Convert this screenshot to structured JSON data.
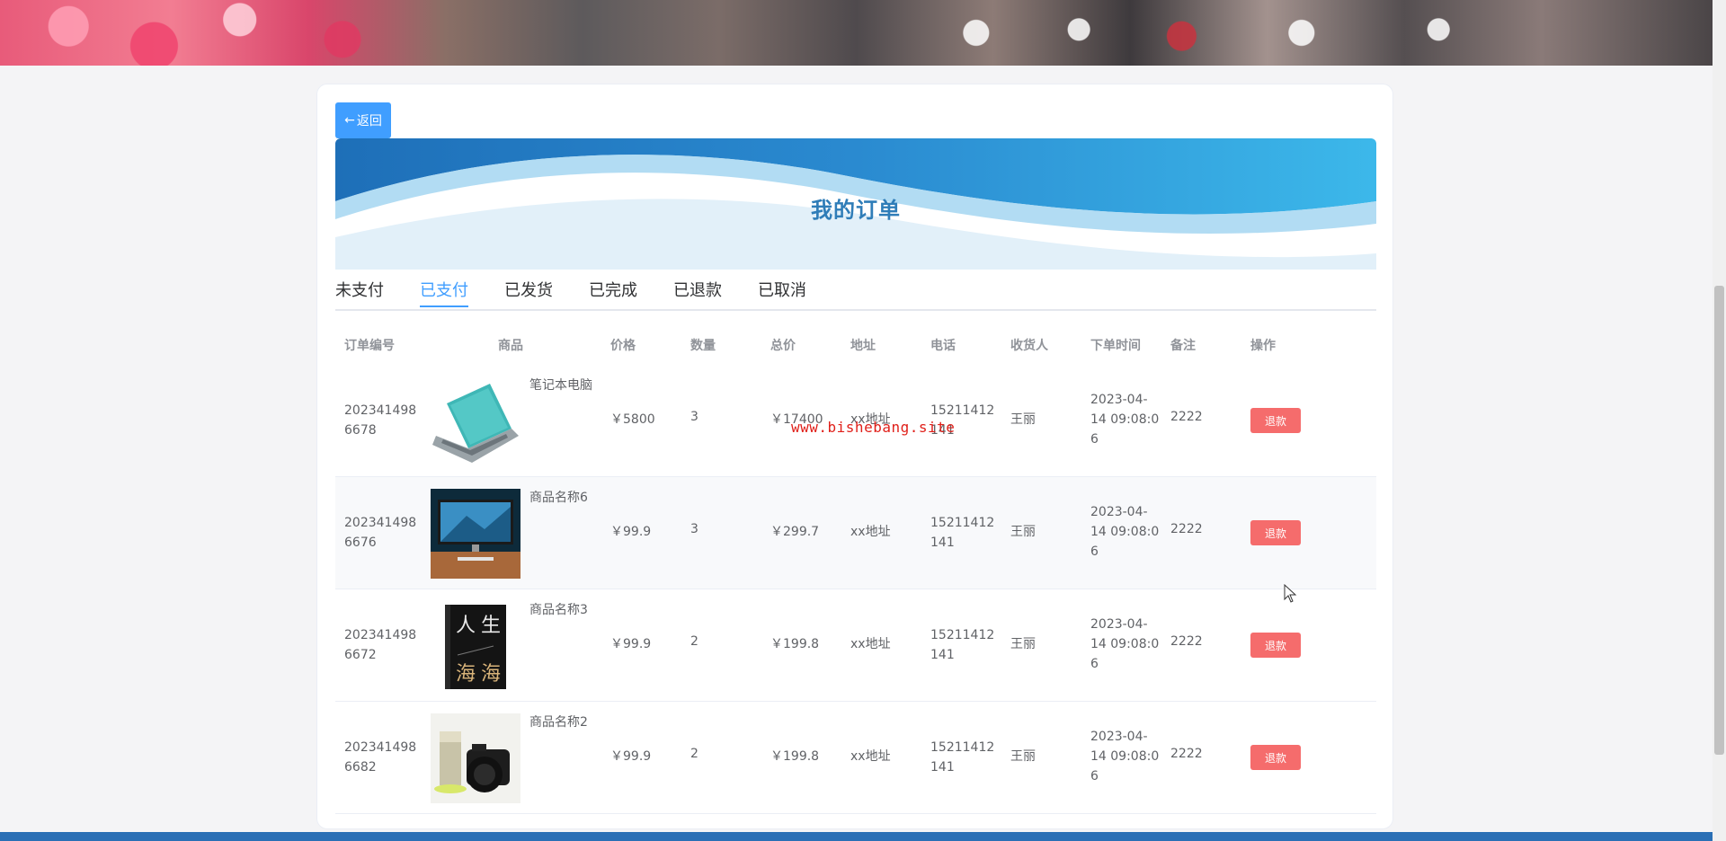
{
  "back_button": {
    "label": "返回"
  },
  "banner": {
    "title": "我的订单"
  },
  "tabs": [
    {
      "label": "未支付",
      "active": false
    },
    {
      "label": "已支付",
      "active": true
    },
    {
      "label": "已发货",
      "active": false
    },
    {
      "label": "已完成",
      "active": false
    },
    {
      "label": "已退款",
      "active": false
    },
    {
      "label": "已取消",
      "active": false
    }
  ],
  "columns": [
    "订单编号",
    "商品",
    "价格",
    "数量",
    "总价",
    "地址",
    "电话",
    "收货人",
    "下单时间",
    "备注",
    "操作"
  ],
  "orders": [
    {
      "order_id_1": "202341498",
      "order_id_2": "6678",
      "product": "笔记本电脑",
      "price": "￥5800",
      "qty": "3",
      "total": "￥17400",
      "address": "xx地址",
      "phone_1": "15211412",
      "phone_2": "141",
      "receiver": "王丽",
      "time_1": "2023-04-",
      "time_2": "14 09:08:0",
      "time_3": "6",
      "note": "2222",
      "action": "退款",
      "image": "laptop"
    },
    {
      "order_id_1": "202341498",
      "order_id_2": "6676",
      "product": "商品名称6",
      "price": "￥99.9",
      "qty": "3",
      "total": "￥299.7",
      "address": "xx地址",
      "phone_1": "15211412",
      "phone_2": "141",
      "receiver": "王丽",
      "time_1": "2023-04-",
      "time_2": "14 09:08:0",
      "time_3": "6",
      "note": "2222",
      "action": "退款",
      "image": "monitor"
    },
    {
      "order_id_1": "202341498",
      "order_id_2": "6672",
      "product": "商品名称3",
      "price": "￥99.9",
      "qty": "2",
      "total": "￥199.8",
      "address": "xx地址",
      "phone_1": "15211412",
      "phone_2": "141",
      "receiver": "王丽",
      "time_1": "2023-04-",
      "time_2": "14 09:08:0",
      "time_3": "6",
      "note": "2222",
      "action": "退款",
      "image": "book"
    },
    {
      "order_id_1": "202341498",
      "order_id_2": "6682",
      "product": "商品名称2",
      "price": "￥99.9",
      "qty": "2",
      "total": "￥199.8",
      "address": "xx地址",
      "phone_1": "15211412",
      "phone_2": "141",
      "receiver": "王丽",
      "time_1": "2023-04-",
      "time_2": "14 09:08:0",
      "time_3": "6",
      "note": "2222",
      "action": "退款",
      "image": "camera"
    }
  ],
  "watermark": "www.bishebang.site",
  "colors": {
    "primary": "#409eff",
    "danger": "#f56c6c",
    "banner_blue": "#1e73be",
    "title_blue": "#2f7db8"
  }
}
